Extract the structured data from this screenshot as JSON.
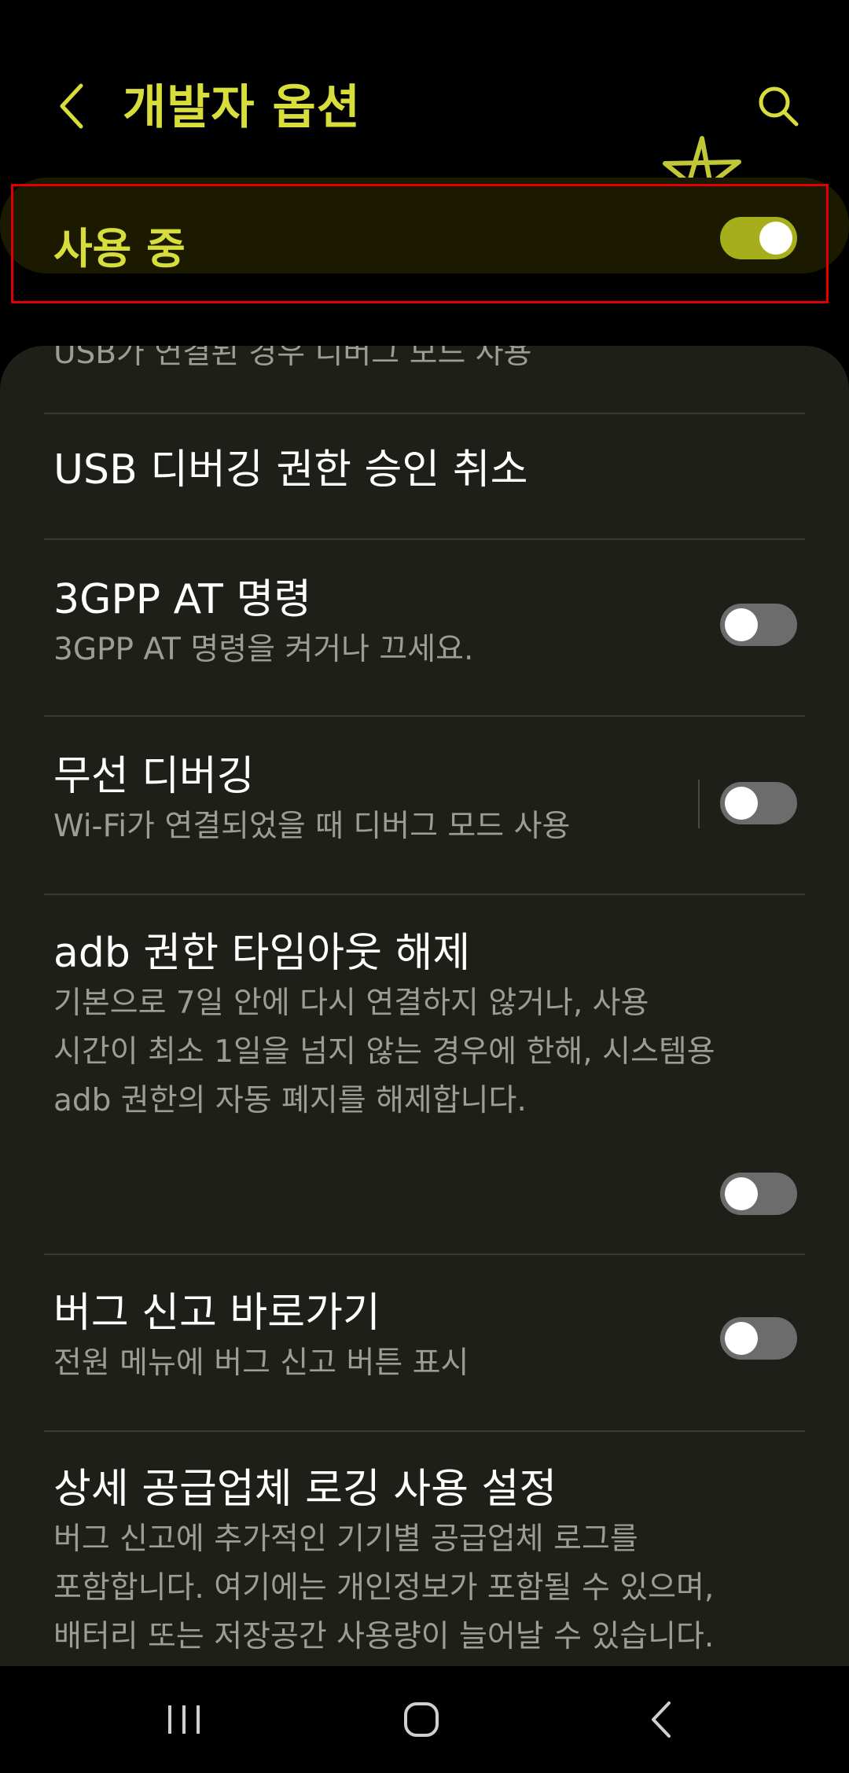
{
  "header": {
    "back_icon": "chevron-left-icon",
    "title": "개발자 옵션",
    "search_icon": "search-icon",
    "accent_color": "#d7de3b"
  },
  "master_switch": {
    "label": "사용 중",
    "state": "on"
  },
  "list": {
    "partial_item": "USB가 연결된 경우 디버그 모드 사용",
    "items": [
      {
        "title": "USB 디버깅 권한 승인 취소"
      },
      {
        "title": "3GPP AT 명령",
        "subtitle": "3GPP AT 명령을 켜거나 끄세요.",
        "toggle": "off"
      },
      {
        "title": "무선 디버깅",
        "subtitle": "Wi-Fi가 연결되었을 때 디버그 모드 사용",
        "toggle": "off"
      },
      {
        "title": "adb 권한 타임아웃 해제",
        "subtitle_lines": [
          "기본으로 7일 안에 다시 연결하지 않거나, 사용",
          "시간이 최소 1일을 넘지 않는 경우에 한해, 시스템용",
          "adb 권한의 자동 폐지를 해제합니다."
        ],
        "toggle": "off"
      },
      {
        "title": "버그 신고 바로가기",
        "subtitle": "전원 메뉴에 버그 신고 버튼 표시",
        "toggle": "off"
      },
      {
        "title": "상세 공급업체 로깅 사용 설정",
        "subtitle_lines": [
          "버그 신고에 추가적인 기기별 공급업체 로그를",
          "포함합니다. 여기에는 개인정보가 포함될 수 있으며,",
          "배터리 또는 저장공간 사용량이 늘어날 수 있습니다."
        ]
      }
    ]
  },
  "navbar": {
    "recents_icon": "recents-icon",
    "home_icon": "home-icon",
    "back_icon": "back-icon"
  }
}
